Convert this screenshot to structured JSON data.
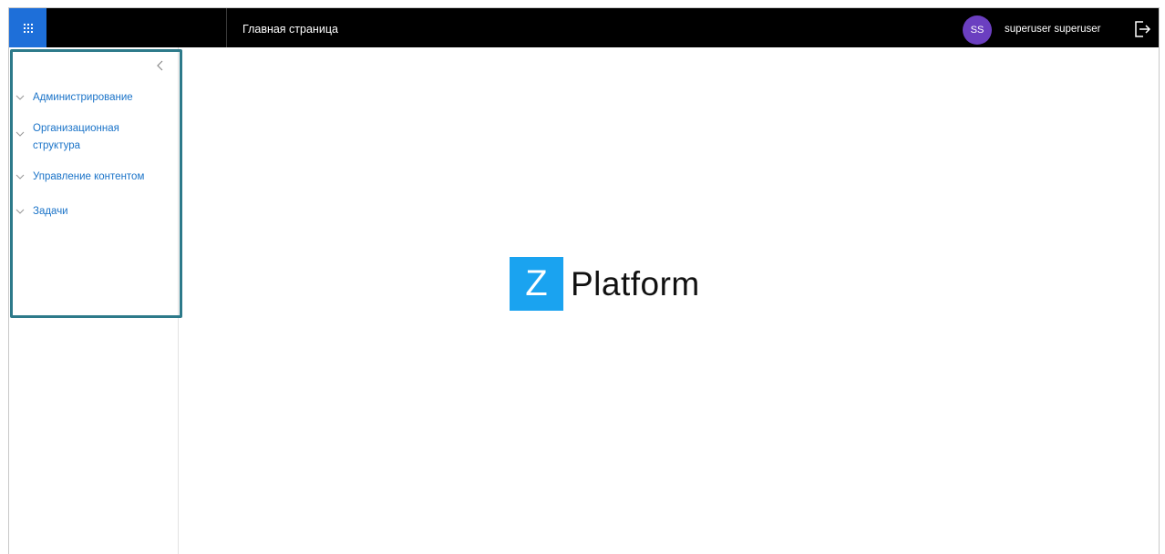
{
  "header": {
    "page_title": "Главная страница",
    "avatar_initials": "SS",
    "user_name": "superuser superuser",
    "launcher_icon": "waffle-grid-icon",
    "logout_icon": "logout-icon"
  },
  "sidebar": {
    "collapse_icon": "chevron-left-icon",
    "items": [
      {
        "label": "Администрирование"
      },
      {
        "label": "Организационная структура"
      },
      {
        "label": "Управление контентом"
      },
      {
        "label": "Задачи"
      }
    ]
  },
  "main": {
    "logo_letter": "Z",
    "logo_text": "Platform"
  },
  "colors": {
    "topbar": "#000000",
    "launcher": "#1e6fd9",
    "avatar": "#6b3fc0",
    "nav_link": "#1a73c8",
    "highlight_border": "#2d7a8a",
    "logo_box": "#1aa3f0"
  }
}
